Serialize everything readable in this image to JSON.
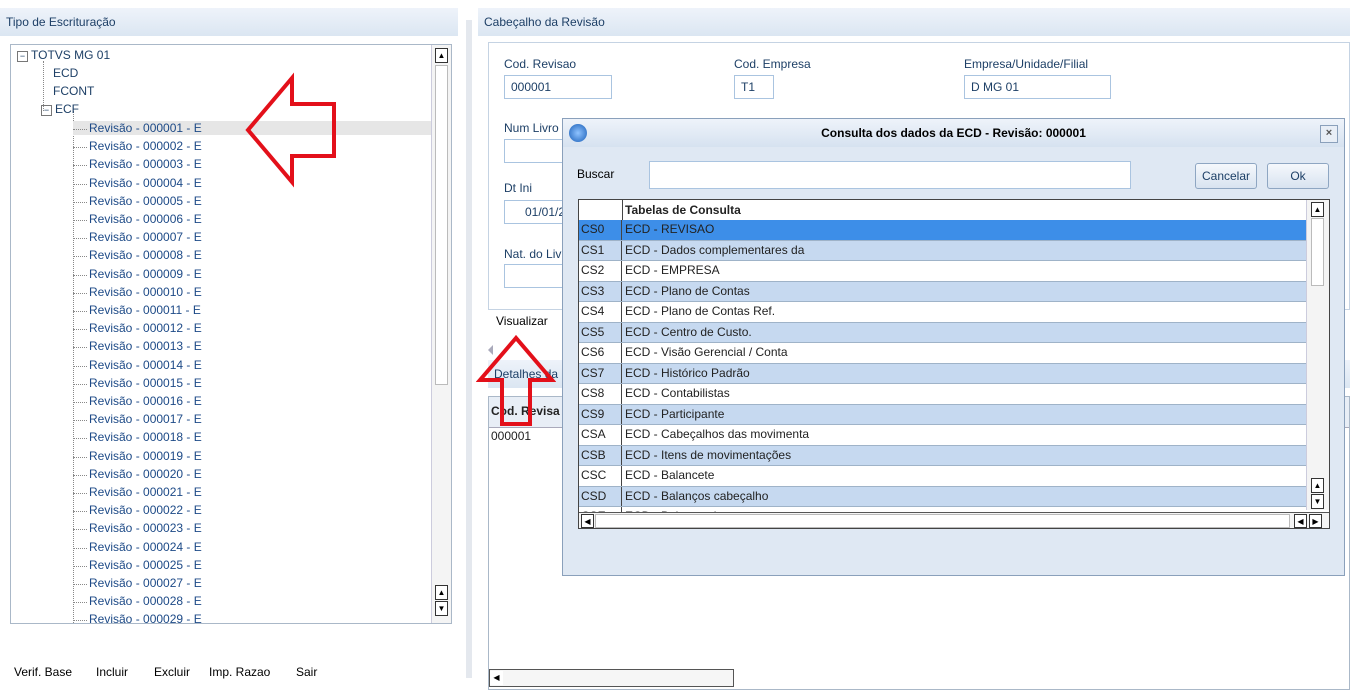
{
  "left_panel": {
    "title": "Tipo de Escrituração",
    "tree": {
      "root": "TOTVS MG 01",
      "children": [
        "ECD",
        "FCONT",
        "ECF"
      ],
      "revisions": [
        "Revisão - 000001 - E",
        "Revisão - 000002 - E",
        "Revisão - 000003 - E",
        "Revisão - 000004 - E",
        "Revisão - 000005 - E",
        "Revisão - 000006 - E",
        "Revisão - 000007 - E",
        "Revisão - 000008 - E",
        "Revisão - 000009 - E",
        "Revisão - 000010 - E",
        "Revisão - 000011 - E",
        "Revisão - 000012 - E",
        "Revisão - 000013 - E",
        "Revisão - 000014 - E",
        "Revisão - 000015 - E",
        "Revisão - 000016 - E",
        "Revisão - 000017 - E",
        "Revisão - 000018 - E",
        "Revisão - 000019 - E",
        "Revisão - 000020 - E",
        "Revisão - 000021 - E",
        "Revisão - 000022 - E",
        "Revisão - 000023 - E",
        "Revisão - 000024 - E",
        "Revisão - 000025 - E",
        "Revisão - 000027 - E",
        "Revisão - 000028 - E",
        "Revisão - 000029 - E"
      ]
    },
    "footer_buttons": [
      "Verif. Base",
      "Incluir",
      "Excluir",
      "Imp. Razao",
      "Sair"
    ]
  },
  "right_panel": {
    "title": "Cabeçalho da Revisão",
    "cod_revisao_label": "Cod. Revisao",
    "cod_revisao_value": "000001",
    "cod_empresa_label": "Cod. Empresa",
    "cod_empresa_value": "T1",
    "empresa_label": "Empresa/Unidade/Filial",
    "empresa_value": "D MG 01",
    "num_livro_label": "Num Livro",
    "dt_ini_label": "Dt Ini",
    "dt_ini_value": "01/01/2",
    "nat_livro_label": "Nat. do Liv",
    "visualizar_label": "Visualizar",
    "detalhes_label": "Detalhes da",
    "detail_col_header": "Cod. Revisa",
    "detail_row_value": "000001"
  },
  "modal": {
    "title": "Consulta dos dados da ECD - Revisão: 000001",
    "buscar_label": "Buscar",
    "search_value": "",
    "cancel_label": "Cancelar",
    "ok_label": "Ok",
    "grid_header": "Tabelas de Consulta",
    "rows": [
      {
        "code": "CS0",
        "desc": "ECD - REVISAO"
      },
      {
        "code": "CS1",
        "desc": "ECD - Dados complementares da"
      },
      {
        "code": "CS2",
        "desc": "ECD - EMPRESA"
      },
      {
        "code": "CS3",
        "desc": "ECD - Plano de Contas"
      },
      {
        "code": "CS4",
        "desc": "ECD - Plano de Contas Ref."
      },
      {
        "code": "CS5",
        "desc": "ECD - Centro de Custo."
      },
      {
        "code": "CS6",
        "desc": "ECD - Visão Gerencial / Conta"
      },
      {
        "code": "CS7",
        "desc": "ECD - Histórico Padrão"
      },
      {
        "code": "CS8",
        "desc": "ECD - Contabilistas"
      },
      {
        "code": "CS9",
        "desc": "ECD - Participante"
      },
      {
        "code": "CSA",
        "desc": "ECD - Cabeçalhos das movimenta"
      },
      {
        "code": "CSB",
        "desc": "ECD - Itens de movimentações"
      },
      {
        "code": "CSC",
        "desc": "ECD - Balancete"
      },
      {
        "code": "CSD",
        "desc": "ECD - Balanços cabeçalho"
      },
      {
        "code": "CSE",
        "desc": "ECD - Balanços itens"
      }
    ]
  },
  "colors": {
    "selected_row": "#3d8ee8",
    "alt_row": "#c6d9f0",
    "annotation_arrow": "#e3101a"
  }
}
